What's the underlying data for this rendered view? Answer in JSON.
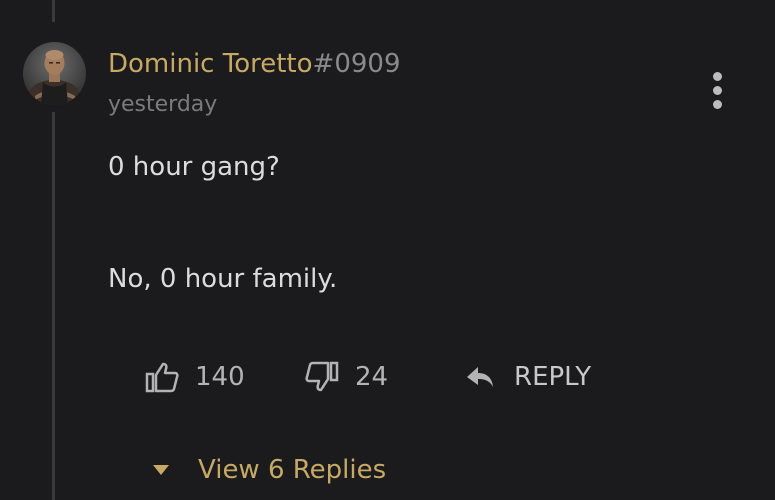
{
  "comment": {
    "author": "Dominic Toretto",
    "tag": "#0909",
    "timestamp": "yesterday",
    "lines": [
      "0 hour gang?",
      "No, 0 hour family."
    ]
  },
  "actions": {
    "likes": "140",
    "dislikes": "24",
    "reply_label": "REPLY"
  },
  "replies": {
    "label": "View 6 Replies"
  },
  "colors": {
    "background": "#1b1a1c",
    "accent": "#c6a965",
    "text": "#dcdcde",
    "muted": "#7b7b7d"
  },
  "icons": [
    "thumbs-up-icon",
    "thumbs-down-icon",
    "reply-arrow-icon",
    "more-vertical-icon",
    "caret-down-icon"
  ]
}
